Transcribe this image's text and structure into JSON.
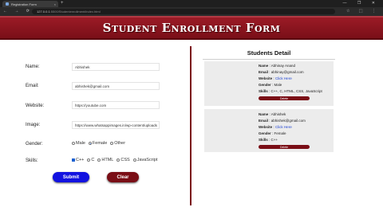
{
  "browser": {
    "tab_title": "Registration Form",
    "tab_close": "×",
    "new_tab": "+",
    "url_host": "127.0.0.1",
    "url_path": ":5500/Studentenrollment/index.html",
    "window_controls": "— ❐ ✕",
    "nav_icons": "← → ⟳",
    "right_icons": "☆ ⬚ ⋮"
  },
  "header": {
    "title": "Student Enrollment Form"
  },
  "form": {
    "name_label": "Name:",
    "name_value": "Abhishek",
    "email_label": "Email:",
    "email_value": "abhishek@gmail.com",
    "website_label": "Website:",
    "website_value": "https://youtube.com",
    "image_label": "Image:",
    "image_value": "https://www.whatsappimages.in/wp-content/uploads",
    "gender_label": "Gender:",
    "gender_options": [
      "Male",
      "Female",
      "Other"
    ],
    "gender_selected": "Female",
    "skills_label": "Skills:",
    "skills_options": [
      "C++",
      "C",
      "HTML",
      "CSS",
      "JavaScript"
    ],
    "skills_checked": [
      "C++"
    ],
    "submit_label": "Submit",
    "clear_label": "Clear"
  },
  "details": {
    "title": "Students Detail",
    "cards": [
      {
        "name_key": "Name",
        "name": "Abhinay Anand",
        "email_key": "Email",
        "email": "abhinay@gmail.com",
        "website_key": "Website",
        "website": "Click Here",
        "gender_key": "Gender",
        "gender": "Male",
        "skills_key": "Skills",
        "skills": "C++, C, HTML, CSS, JavaScript",
        "delete_label": "Delete"
      },
      {
        "name_key": "Name",
        "name": "Abhishek",
        "email_key": "Email",
        "email": "abhishek@gmail.com",
        "website_key": "Website",
        "website": "Click Here",
        "gender_key": "Gender",
        "gender": "Female",
        "skills_key": "Skills",
        "skills": "C++",
        "delete_label": "Delete"
      }
    ]
  },
  "colors": {
    "accent": "#7a0f18",
    "submit": "#1212e0",
    "link": "#1a3fd0"
  }
}
